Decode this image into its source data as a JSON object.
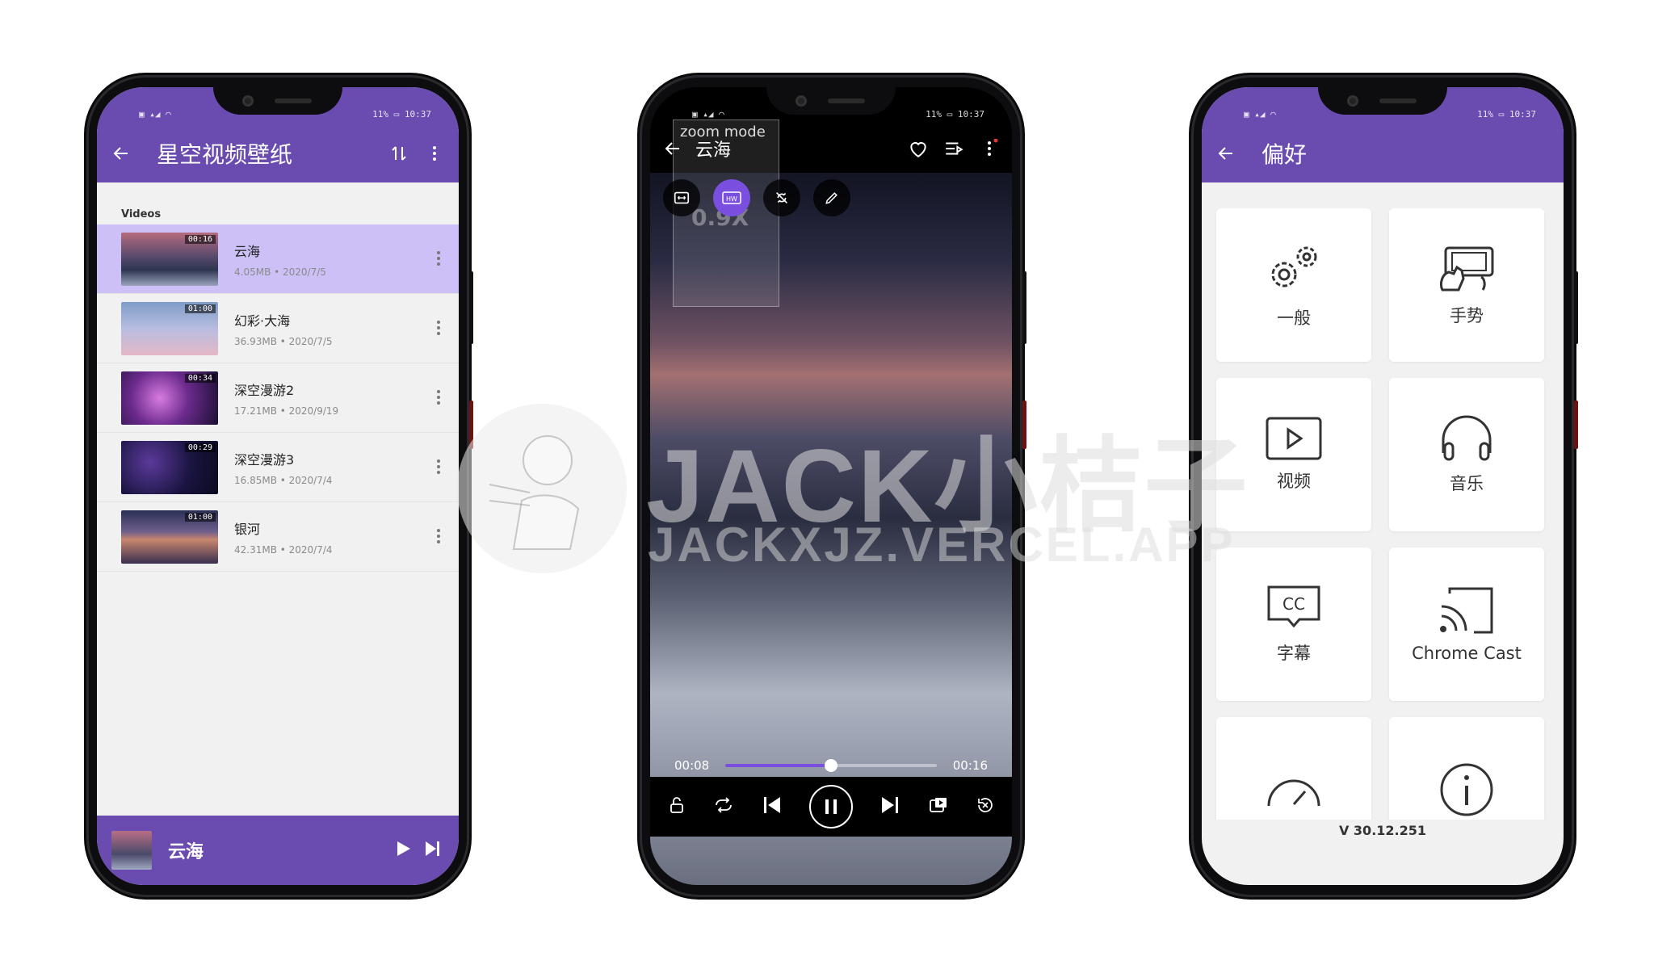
{
  "colors": {
    "brand_purple": "#6a4bb0",
    "selected_row": "#cdc0f6",
    "accent": "#7a4fe0"
  },
  "status_bar": {
    "time": "10:37",
    "battery": "11%"
  },
  "phone1": {
    "title": "星空视频壁纸",
    "section_label": "Videos",
    "videos": [
      {
        "name": "云海",
        "info": "4.05MB • 2020/7/5",
        "duration": "00:16",
        "selected": true
      },
      {
        "name": "幻彩·大海",
        "info": "36.93MB • 2020/7/5",
        "duration": "01:00",
        "selected": false
      },
      {
        "name": "深空漫游2",
        "info": "17.21MB • 2020/9/19",
        "duration": "00:34",
        "selected": false
      },
      {
        "name": "深空漫游3",
        "info": "16.85MB • 2020/7/4",
        "duration": "00:29",
        "selected": false
      },
      {
        "name": "银河",
        "info": "42.31MB • 2020/7/4",
        "duration": "01:00",
        "selected": false
      }
    ],
    "mini_player": {
      "title": "云海"
    },
    "icons": [
      "back-arrow-icon",
      "sort-icon",
      "more-vert-icon",
      "play-icon",
      "skip-next-icon"
    ]
  },
  "phone2": {
    "title": "云海",
    "zoom_label": "zoom mode",
    "zoom_value": "0.9X",
    "current_time": "00:08",
    "total_time": "00:16",
    "progress": 0.5,
    "hw_label": "HW"
  },
  "phone3": {
    "title": "偏好",
    "cards": [
      {
        "label": "一般",
        "icon": "gears-icon"
      },
      {
        "label": "手势",
        "icon": "gesture-icon"
      },
      {
        "label": "视频",
        "icon": "video-icon"
      },
      {
        "label": "音乐",
        "icon": "headphones-icon"
      },
      {
        "label": "字幕",
        "icon": "subtitles-icon"
      },
      {
        "label": "Chrome Cast",
        "icon": "cast-icon"
      },
      {
        "label": "",
        "icon": "speedometer-icon"
      },
      {
        "label": "",
        "icon": "info-icon"
      }
    ],
    "version": "V 30.12.251"
  },
  "watermark": {
    "title": "JACK小桔子",
    "subtitle": "JACKXJZ.VERCEL.APP"
  }
}
